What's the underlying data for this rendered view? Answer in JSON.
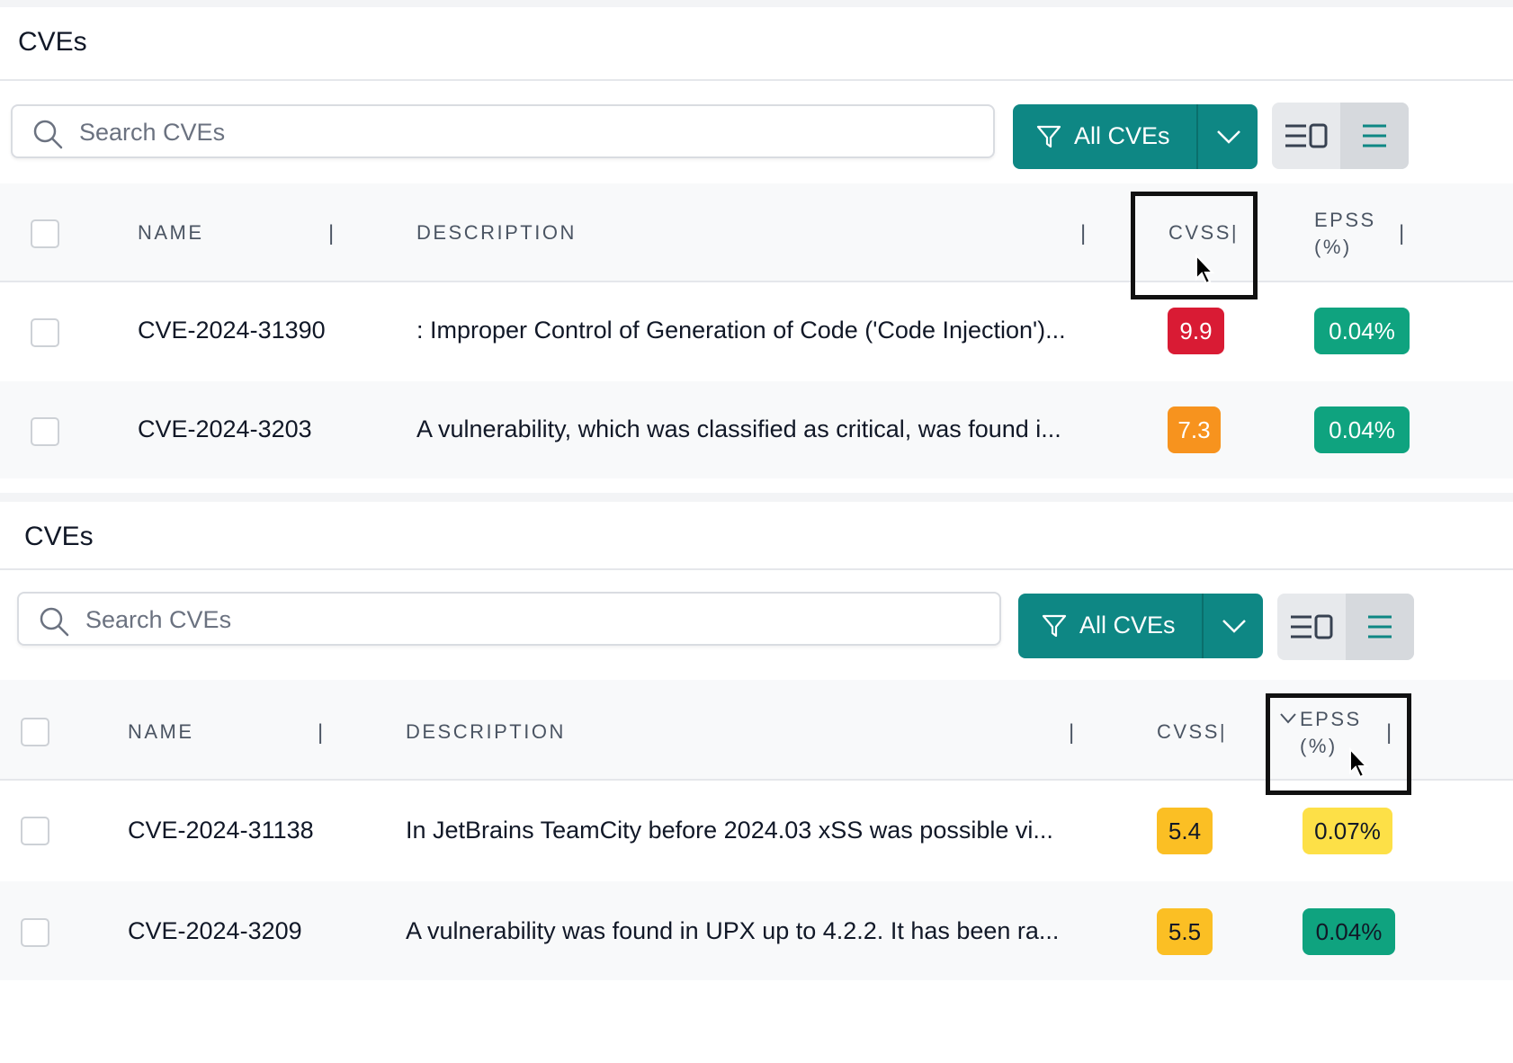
{
  "panels": [
    {
      "title": "CVEs",
      "search_placeholder": "Search CVEs",
      "filter_label": "All CVEs",
      "columns": {
        "name": "NAME",
        "description": "DESCRIPTION",
        "cvss": "CVSS|",
        "epss": "EPSS (%)",
        "separator": "|"
      },
      "rows": [
        {
          "name": "CVE-2024-31390",
          "description": ": Improper Control of Generation of Code ('Code Injection')...",
          "cvss": "9.9",
          "cvss_color": "#d91b34",
          "epss": "0.04%",
          "epss_color": "#0fa37f"
        },
        {
          "name": "CVE-2024-3203",
          "description": "A vulnerability, which was classified as critical, was found i...",
          "cvss": "7.3",
          "cvss_color": "#f7931e",
          "epss": "0.04%",
          "epss_color": "#0fa37f"
        }
      ]
    },
    {
      "title": "CVEs",
      "search_placeholder": "Search CVEs",
      "filter_label": "All CVEs",
      "columns": {
        "name": "NAME",
        "description": "DESCRIPTION",
        "cvss": "CVSS|",
        "epss": "EPSS (%)",
        "separator": "|"
      },
      "rows": [
        {
          "name": "CVE-2024-31138",
          "description": "In JetBrains TeamCity before 2024.03 xSS was possible vi...",
          "cvss": "5.4",
          "cvss_color": "#fbbf24",
          "epss": "0.07%",
          "epss_color": "#fde047"
        },
        {
          "name": "CVE-2024-3209",
          "description": "A vulnerability was found in UPX up to 4.2.2. It has been ra...",
          "cvss": "5.5",
          "cvss_color": "#fbbf24",
          "epss": "0.04%",
          "epss_color": "#0fa37f"
        }
      ]
    }
  ],
  "colors": {
    "accent": "#0e8784",
    "header_bg": "#f8f9fa"
  },
  "icons": {
    "search": "search-icon",
    "filter": "filter-icon",
    "dropdown": "chevron-down-icon",
    "split_view": "split-view-icon",
    "list_view": "list-view-icon",
    "sort": "chevron-down-icon"
  }
}
